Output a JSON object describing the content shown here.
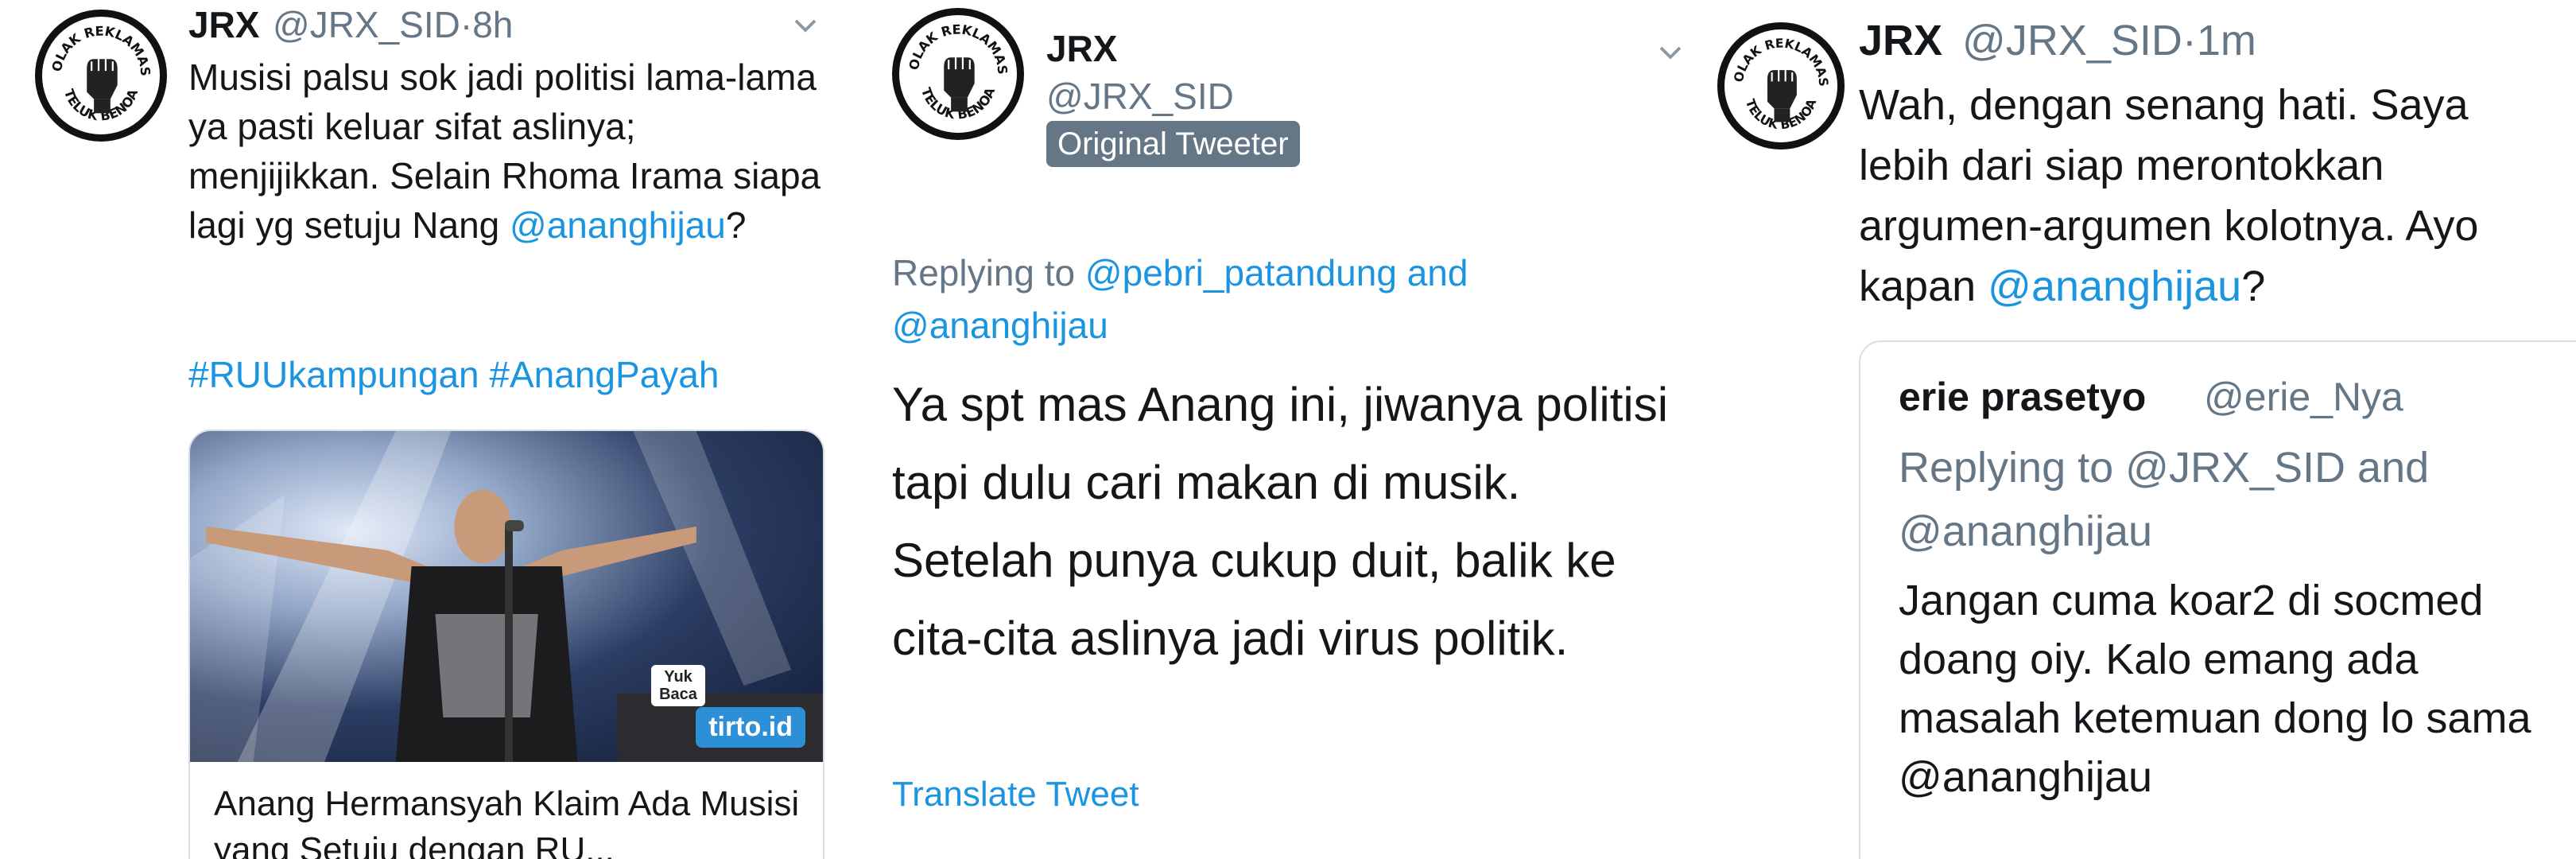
{
  "panels": [
    {
      "name": "JRX",
      "handle": "@JRX_SID",
      "time": "·8h",
      "text": "Musisi palsu sok jadi politisi lama-lama ya pasti keluar sifat aslinya; menjijikkan. Selain Rhoma Irama siapa lagi yg setuju Nang ",
      "mention": "@ananghijau",
      "text_end": "?",
      "hashtags": "#RUUkampungan #AnangPayah",
      "card": {
        "title": "Anang Hermansyah Klaim Ada Musisi yang Setuju dengan RU...",
        "badge": "tirto.id",
        "sticker": "Yuk Baca"
      }
    },
    {
      "name": "JRX",
      "handle": "@JRX_SID",
      "badge": "Original Tweeter",
      "replying_prefix": "Replying to ",
      "replying_to_1": "@pebri_patandung",
      "replying_and": " and ",
      "replying_to_2": "@ananghijau",
      "text": "Ya spt mas Anang ini, jiwanya politisi tapi dulu cari makan di musik. Setelah punya cukup duit, balik ke cita-cita aslinya jadi virus politik.",
      "translate": "Translate Tweet"
    },
    {
      "name": "JRX",
      "handle": "@JRX_SID",
      "time": "·1m",
      "text": "Wah, dengan senang hati. Saya lebih dari siap merontokkan argumen-argumen kolotnya. Ayo kapan ",
      "mention": "@ananghijau",
      "text_end": "?",
      "quote": {
        "name": "erie prasetyo",
        "handle": "@erie_Nya",
        "replying": "Replying to @JRX_SID and @ananghijau",
        "text": "Jangan cuma koar2 di socmed doang oiy. Kalo emang ada masalah ketemuan dong lo sama @ananghijau",
        "more": "..."
      }
    }
  ],
  "avatar_text": {
    "top": "TOLAK REKLAMASI",
    "bottom": "TELUK BENOA"
  },
  "colors": {
    "link": "#1b95e0",
    "secondary": "#657786",
    "primary": "#14171a"
  }
}
